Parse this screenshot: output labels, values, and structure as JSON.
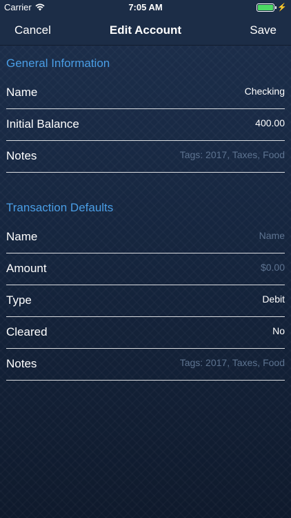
{
  "status_bar": {
    "carrier": "Carrier",
    "time": "7:05 AM",
    "battery_level": 1.0,
    "battery_color": "#4cd964"
  },
  "nav": {
    "cancel_label": "Cancel",
    "title": "Edit Account",
    "save_label": "Save"
  },
  "general": {
    "header": "General Information",
    "rows": [
      {
        "label": "Name",
        "value": "Checking",
        "placeholder": ""
      },
      {
        "label": "Initial Balance",
        "value": "400.00",
        "placeholder": ""
      },
      {
        "label": "Notes",
        "value": "",
        "placeholder": "Tags: 2017, Taxes, Food"
      }
    ]
  },
  "defaults": {
    "header": "Transaction Defaults",
    "rows": [
      {
        "label": "Name",
        "value": "",
        "placeholder": "Name"
      },
      {
        "label": "Amount",
        "value": "",
        "placeholder": "$0.00"
      },
      {
        "label": "Type",
        "value": "Debit",
        "placeholder": ""
      },
      {
        "label": "Cleared",
        "value": "No",
        "placeholder": ""
      },
      {
        "label": "Notes",
        "value": "",
        "placeholder": "Tags: 2017, Taxes, Food"
      }
    ]
  },
  "colors": {
    "section_header": "#4a9ee6",
    "background": "#14223a",
    "placeholder": "#5d7390"
  }
}
